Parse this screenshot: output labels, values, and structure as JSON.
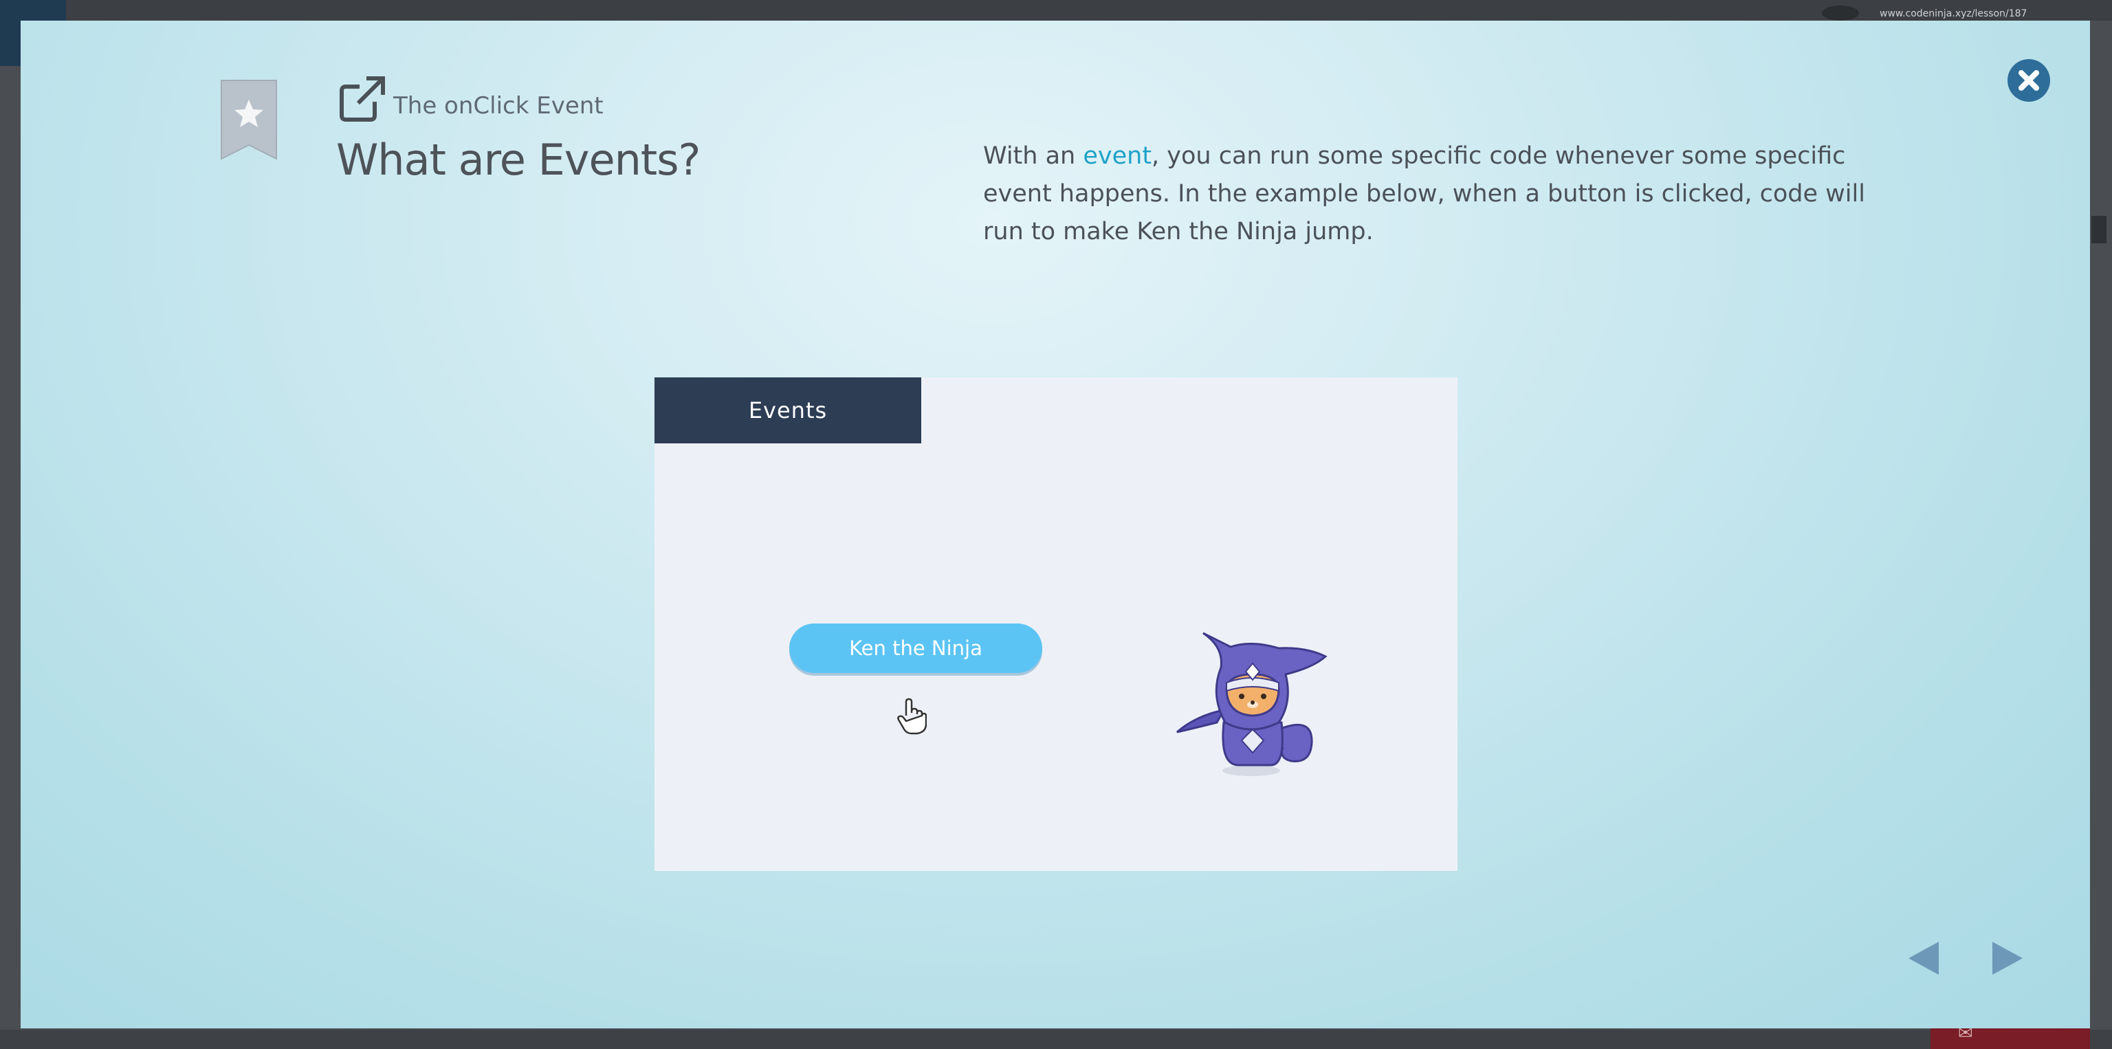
{
  "background": {
    "url_text": "www.codeninja.xyz/lesson/187"
  },
  "modal": {
    "lesson_label": "The onClick Event",
    "slide_title": "What are Events?",
    "description": {
      "prefix": "With an ",
      "keyword": "event",
      "rest": ", you can run some specific code whenever some specific event happens. In the example below, when a button is clicked, code will run to make Ken the Ninja jump."
    },
    "demo": {
      "header": "Events",
      "button_label": "Ken the Ninja"
    }
  },
  "colors": {
    "accent": "#1ea2c8",
    "header_bg": "#2c3d54",
    "button_bg": "#5cc4f4",
    "close_bg": "#2e6d9a",
    "nav_arrow": "#6d98b8"
  },
  "icons": [
    "bookmark-star-icon",
    "external-link-icon",
    "close-icon",
    "hand-cursor-icon",
    "prev-arrow-icon",
    "next-arrow-icon"
  ]
}
